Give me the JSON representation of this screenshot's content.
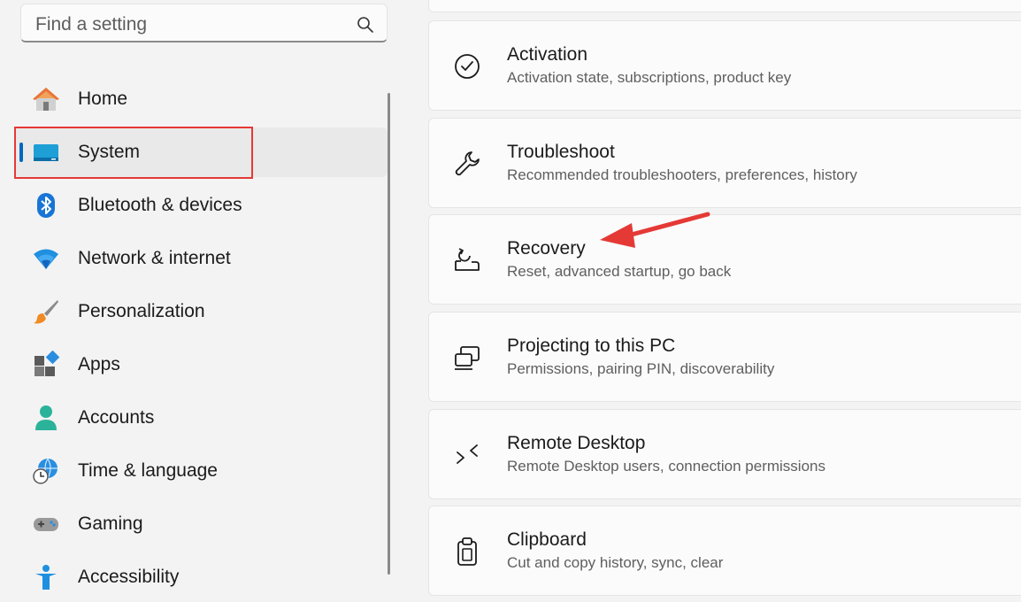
{
  "search": {
    "placeholder": "Find a setting"
  },
  "sidebar": {
    "items": [
      {
        "label": "Home",
        "icon": "home-icon"
      },
      {
        "label": "System",
        "icon": "system-icon",
        "selected": true
      },
      {
        "label": "Bluetooth & devices",
        "icon": "bluetooth-icon"
      },
      {
        "label": "Network & internet",
        "icon": "wifi-icon"
      },
      {
        "label": "Personalization",
        "icon": "brush-icon"
      },
      {
        "label": "Apps",
        "icon": "apps-icon"
      },
      {
        "label": "Accounts",
        "icon": "accounts-icon"
      },
      {
        "label": "Time & language",
        "icon": "time-language-icon"
      },
      {
        "label": "Gaming",
        "icon": "gamepad-icon"
      },
      {
        "label": "Accessibility",
        "icon": "accessibility-icon"
      }
    ]
  },
  "cards": [
    {
      "title": "Activation",
      "subtitle": "Activation state, subscriptions, product key",
      "icon": "check-circle-icon"
    },
    {
      "title": "Troubleshoot",
      "subtitle": "Recommended troubleshooters, preferences, history",
      "icon": "wrench-icon"
    },
    {
      "title": "Recovery",
      "subtitle": "Reset, advanced startup, go back",
      "icon": "recovery-icon"
    },
    {
      "title": "Projecting to this PC",
      "subtitle": "Permissions, pairing PIN, discoverability",
      "icon": "projecting-icon"
    },
    {
      "title": "Remote Desktop",
      "subtitle": "Remote Desktop users, connection permissions",
      "icon": "remote-desktop-icon"
    },
    {
      "title": "Clipboard",
      "subtitle": "Cut and copy history, sync, clear",
      "icon": "clipboard-icon"
    }
  ],
  "colors": {
    "accent": "#0067c0",
    "annotation": "#e53935"
  }
}
